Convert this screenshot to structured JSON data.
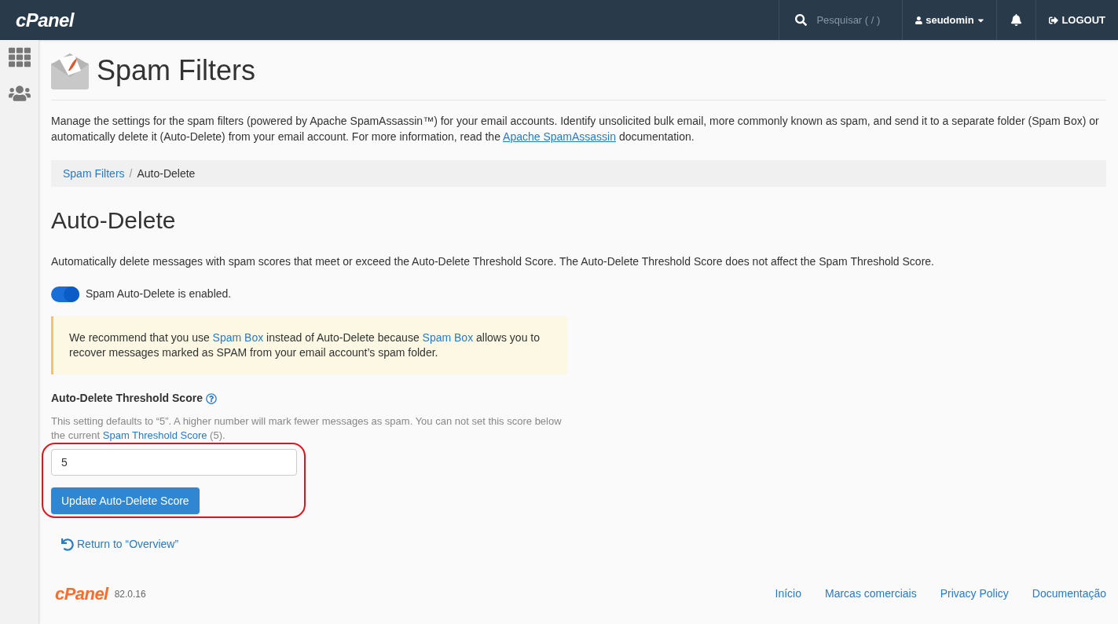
{
  "topbar": {
    "logo": "cPanel",
    "search_placeholder": "Pesquisar ( / )",
    "user": "seudomin",
    "logout": "LOGOUT"
  },
  "page": {
    "title": "Spam Filters",
    "intro": "Manage the settings for the spam filters (powered by Apache SpamAssassin™) for your email accounts. Identify unsolicited bulk email, more commonly known as spam, and send it to a separate folder (Spam Box) or automatically delete it (Auto-Delete) from your email account. For more information, read the ",
    "intro_link": "Apache SpamAssassin",
    "intro_end": " documentation."
  },
  "breadcrumb_separator": "/",
  "breadcrumb": [
    {
      "label": "Spam Filters",
      "kind": "link"
    },
    {
      "label": "Auto-Delete",
      "kind": "current"
    }
  ],
  "section": {
    "title": "Auto-Delete",
    "description": "Automatically delete messages with spam scores that meet or exceed the Auto-Delete Threshold Score. The Auto-Delete Threshold Score does not affect the Spam Threshold Score.",
    "toggle": {
      "on": true,
      "label": "Spam Auto-Delete is enabled."
    }
  },
  "alert": [
    {
      "kind": "text",
      "text": "We recommend that you use "
    },
    {
      "kind": "link",
      "text": "Spam Box"
    },
    {
      "kind": "text",
      "text": " instead of Auto-Delete because "
    },
    {
      "kind": "link",
      "text": "Spam Box"
    },
    {
      "kind": "text",
      "text": " allows you to recover messages marked as SPAM from your email account’s spam folder."
    }
  ],
  "threshold": {
    "label": "Auto-Delete Threshold Score",
    "help": [
      {
        "kind": "text",
        "text": "This setting defaults to “5”. A higher number will mark fewer messages as spam. You can not set this score below the current "
      },
      {
        "kind": "link",
        "text": "Spam Threshold Score"
      },
      {
        "kind": "text",
        "text": " (5)."
      }
    ],
    "value": "5",
    "button": "Update Auto-Delete Score"
  },
  "return_link": "Return to “Overview”",
  "footer": {
    "logo": "cPanel",
    "version": "82.0.16",
    "links": [
      "Início",
      "Marcas comerciais",
      "Privacy Policy",
      "Documentação"
    ]
  }
}
